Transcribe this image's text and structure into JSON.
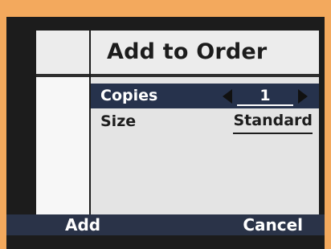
{
  "title": "Add to Order",
  "menu": {
    "rows": [
      {
        "label": "Copies",
        "value": "1"
      },
      {
        "label": "Size",
        "value": "Standard"
      }
    ]
  },
  "footer": {
    "left": "Add",
    "right": "Cancel"
  },
  "icons": {
    "left": "left-arrow-icon",
    "right": "right-arrow-icon"
  },
  "colors": {
    "outer_background": "#f3a95d",
    "frame": "#1c1c1c",
    "screen": "#ececec",
    "selection": "#26324c",
    "footer": "#2a3348"
  }
}
